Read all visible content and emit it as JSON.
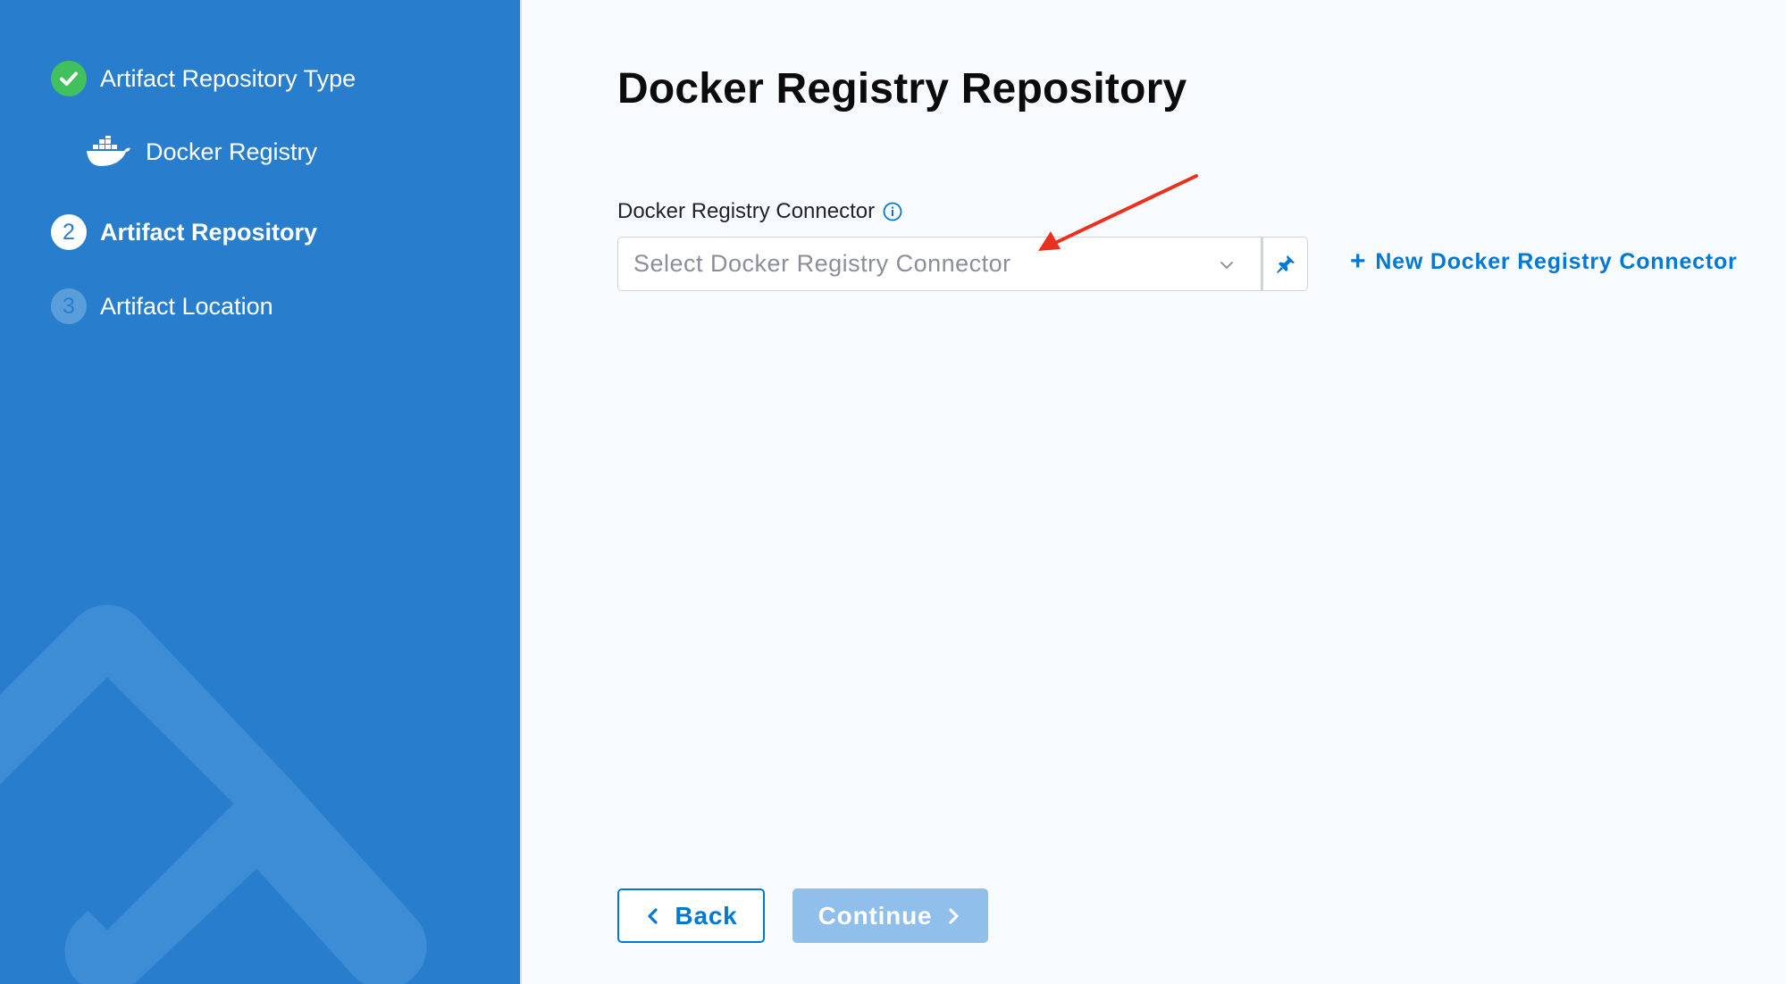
{
  "sidebar": {
    "steps": [
      {
        "number": "",
        "label": "Artifact Repository Type",
        "state": "done"
      },
      {
        "number": "2",
        "label": "Artifact Repository",
        "state": "active"
      },
      {
        "number": "3",
        "label": "Artifact Location",
        "state": "pending"
      }
    ],
    "sub_step": {
      "label": "Docker Registry",
      "icon": "docker-icon"
    }
  },
  "main": {
    "title": "Docker Registry Repository",
    "connector_field": {
      "label": "Docker Registry Connector",
      "placeholder": "Select Docker Registry Connector"
    },
    "new_connector_link": {
      "plus": "+",
      "label": "New Docker Registry Connector"
    },
    "buttons": {
      "back": "Back",
      "continue": "Continue"
    }
  },
  "colors": {
    "sidebar_bg": "#287ecd",
    "step_done": "#42c05d",
    "link": "#0278d5",
    "continue_disabled": "#90bfec",
    "annotation_arrow": "#e8321e"
  }
}
